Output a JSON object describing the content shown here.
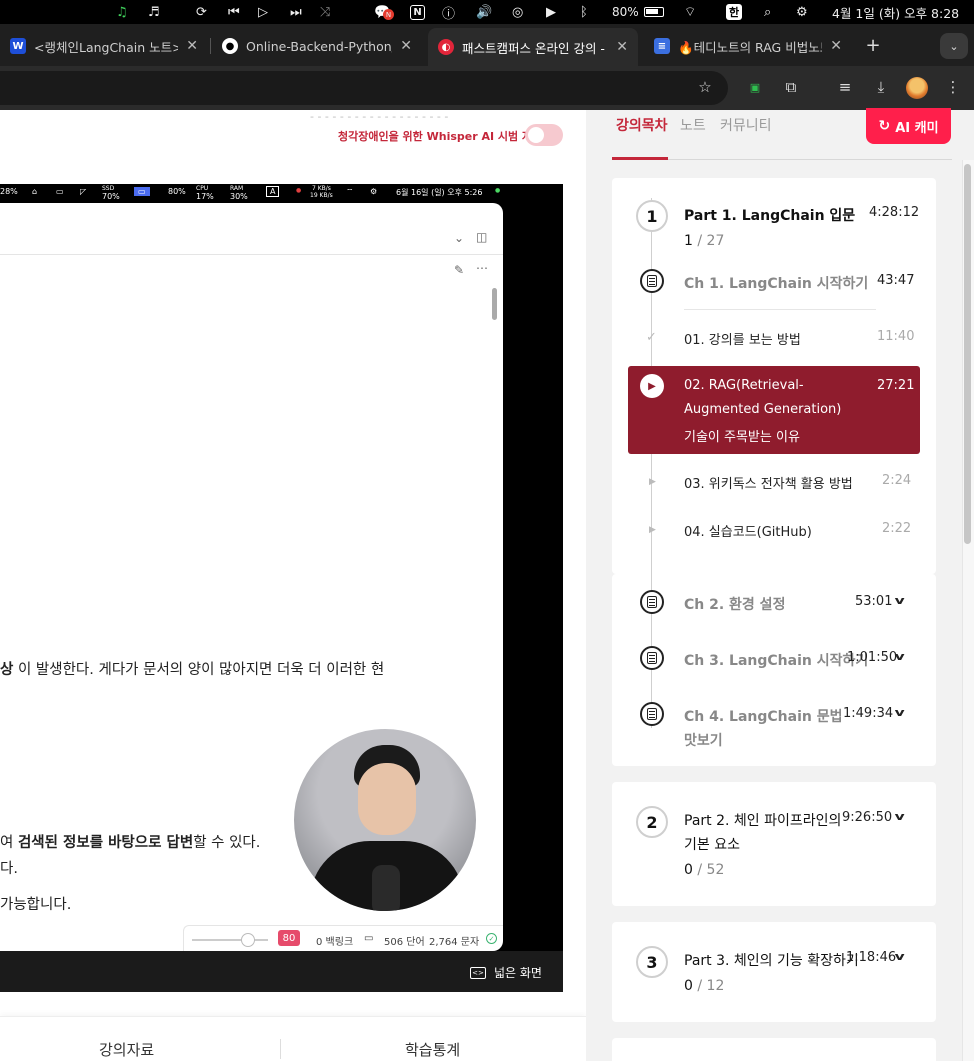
{
  "menubar": {
    "battery_percent": "80%",
    "input_method": "한",
    "clock": "4월 1일 (화) 오후 8:28",
    "notion_icon_letter": "N",
    "notification_badge": "N"
  },
  "tabs": [
    {
      "label": "<랭체인LangChain 노트> - ",
      "icon_letter": "W",
      "icon_color": "#1e4fd8"
    },
    {
      "label": "Online-Backend-Python/",
      "icon_letter": "",
      "icon_color": "#ffffff"
    },
    {
      "label": "패스트캠퍼스 온라인 강의 - ",
      "icon_letter": "",
      "icon_color": "#e2253a"
    },
    {
      "label": "🔥테디노트의 RAG 비법노트",
      "icon_letter": "",
      "icon_color": "#3b6fe0"
    }
  ],
  "page": {
    "faded_top_text": "- - -  - - - - - - - - - - - - - - - -",
    "whisper_label": "청각장애인을 위한 Whisper AI 시범 자막"
  },
  "video": {
    "status_items": {
      "cpu_left": "28%",
      "ssd": "70%",
      "battery": "80%",
      "cpu": "17%",
      "ram": "30%",
      "net_up": "7 KB/s",
      "net_down": "19 KB/s",
      "clock": "6월 16일 (일) 오후 5:26",
      "ime": "A",
      "ssd_label": "SSD",
      "cpu_label": "CPU",
      "ram_label": "RAM"
    },
    "doc_lines": [
      {
        "bold": "상",
        "rest": " 이 발생한다. 게다가 문서의 양이 많아지면 더욱 더 이러한 현"
      },
      {
        "prefix": "여 ",
        "bold": "검색된 정보를 바탕으로 답변",
        "rest": "할 수 있다."
      },
      {
        "prefix": "",
        "bold": "",
        "rest": "다."
      },
      {
        "prefix": "",
        "bold": "",
        "rest": " 가능합니다."
      }
    ],
    "footer": {
      "zoom": "80",
      "backlinks": "0 백링크",
      "words": "506 단어",
      "chars": "2,764 문자"
    },
    "widescreen_label": "넓은 화면"
  },
  "bottom_tabs": {
    "materials": "강의자료",
    "stats": "학습통계"
  },
  "sidebar": {
    "tabs": {
      "curriculum": "강의목차",
      "notes": "노트",
      "community": "커뮤니티"
    },
    "ai_button": "AI 캐미",
    "parts": [
      {
        "number": "1",
        "title": "Part 1. LangChain 입문",
        "duration": "4:28:12",
        "progress_done": "1",
        "progress_total": "27",
        "chapters": [
          {
            "title": "Ch 1. LangChain 시작하기",
            "duration": "43:47",
            "lessons": [
              {
                "title": "01. 강의를 보는 방법",
                "duration": "11:40"
              },
              {
                "title_line1": "02. RAG(Retrieval-",
                "title_line2": "Augmented Generation)",
                "title_line3": "기술이 주목받는 이유",
                "duration": "27:21"
              },
              {
                "title": "03. 위키독스 전자책 활용 방법",
                "duration": "2:24"
              },
              {
                "title": "04. 실습코드(GitHub)",
                "duration": "2:22"
              }
            ]
          },
          {
            "title": "Ch 2. 환경 설정",
            "duration": "53:01"
          },
          {
            "title": "Ch 3. LangChain 시작하기",
            "duration": "1:01:50"
          },
          {
            "title_line1": "Ch 4. LangChain 문법",
            "title_line2": "맛보기",
            "duration": "1:49:34"
          }
        ]
      },
      {
        "number": "2",
        "title_line1": "Part 2. 체인 파이프라인의",
        "title_line2": "기본 요소",
        "duration": "9:26:50",
        "progress_done": "0",
        "progress_total": "52"
      },
      {
        "number": "3",
        "title": "Part 3. 체인의 기능 확장하기",
        "duration": "1:18:46",
        "progress_done": "0",
        "progress_total": "12"
      }
    ]
  },
  "colors": {
    "accent": "#c4273a",
    "active_lesson_bg": "#8f1c2d",
    "ai_button": "#ff1f4b"
  }
}
